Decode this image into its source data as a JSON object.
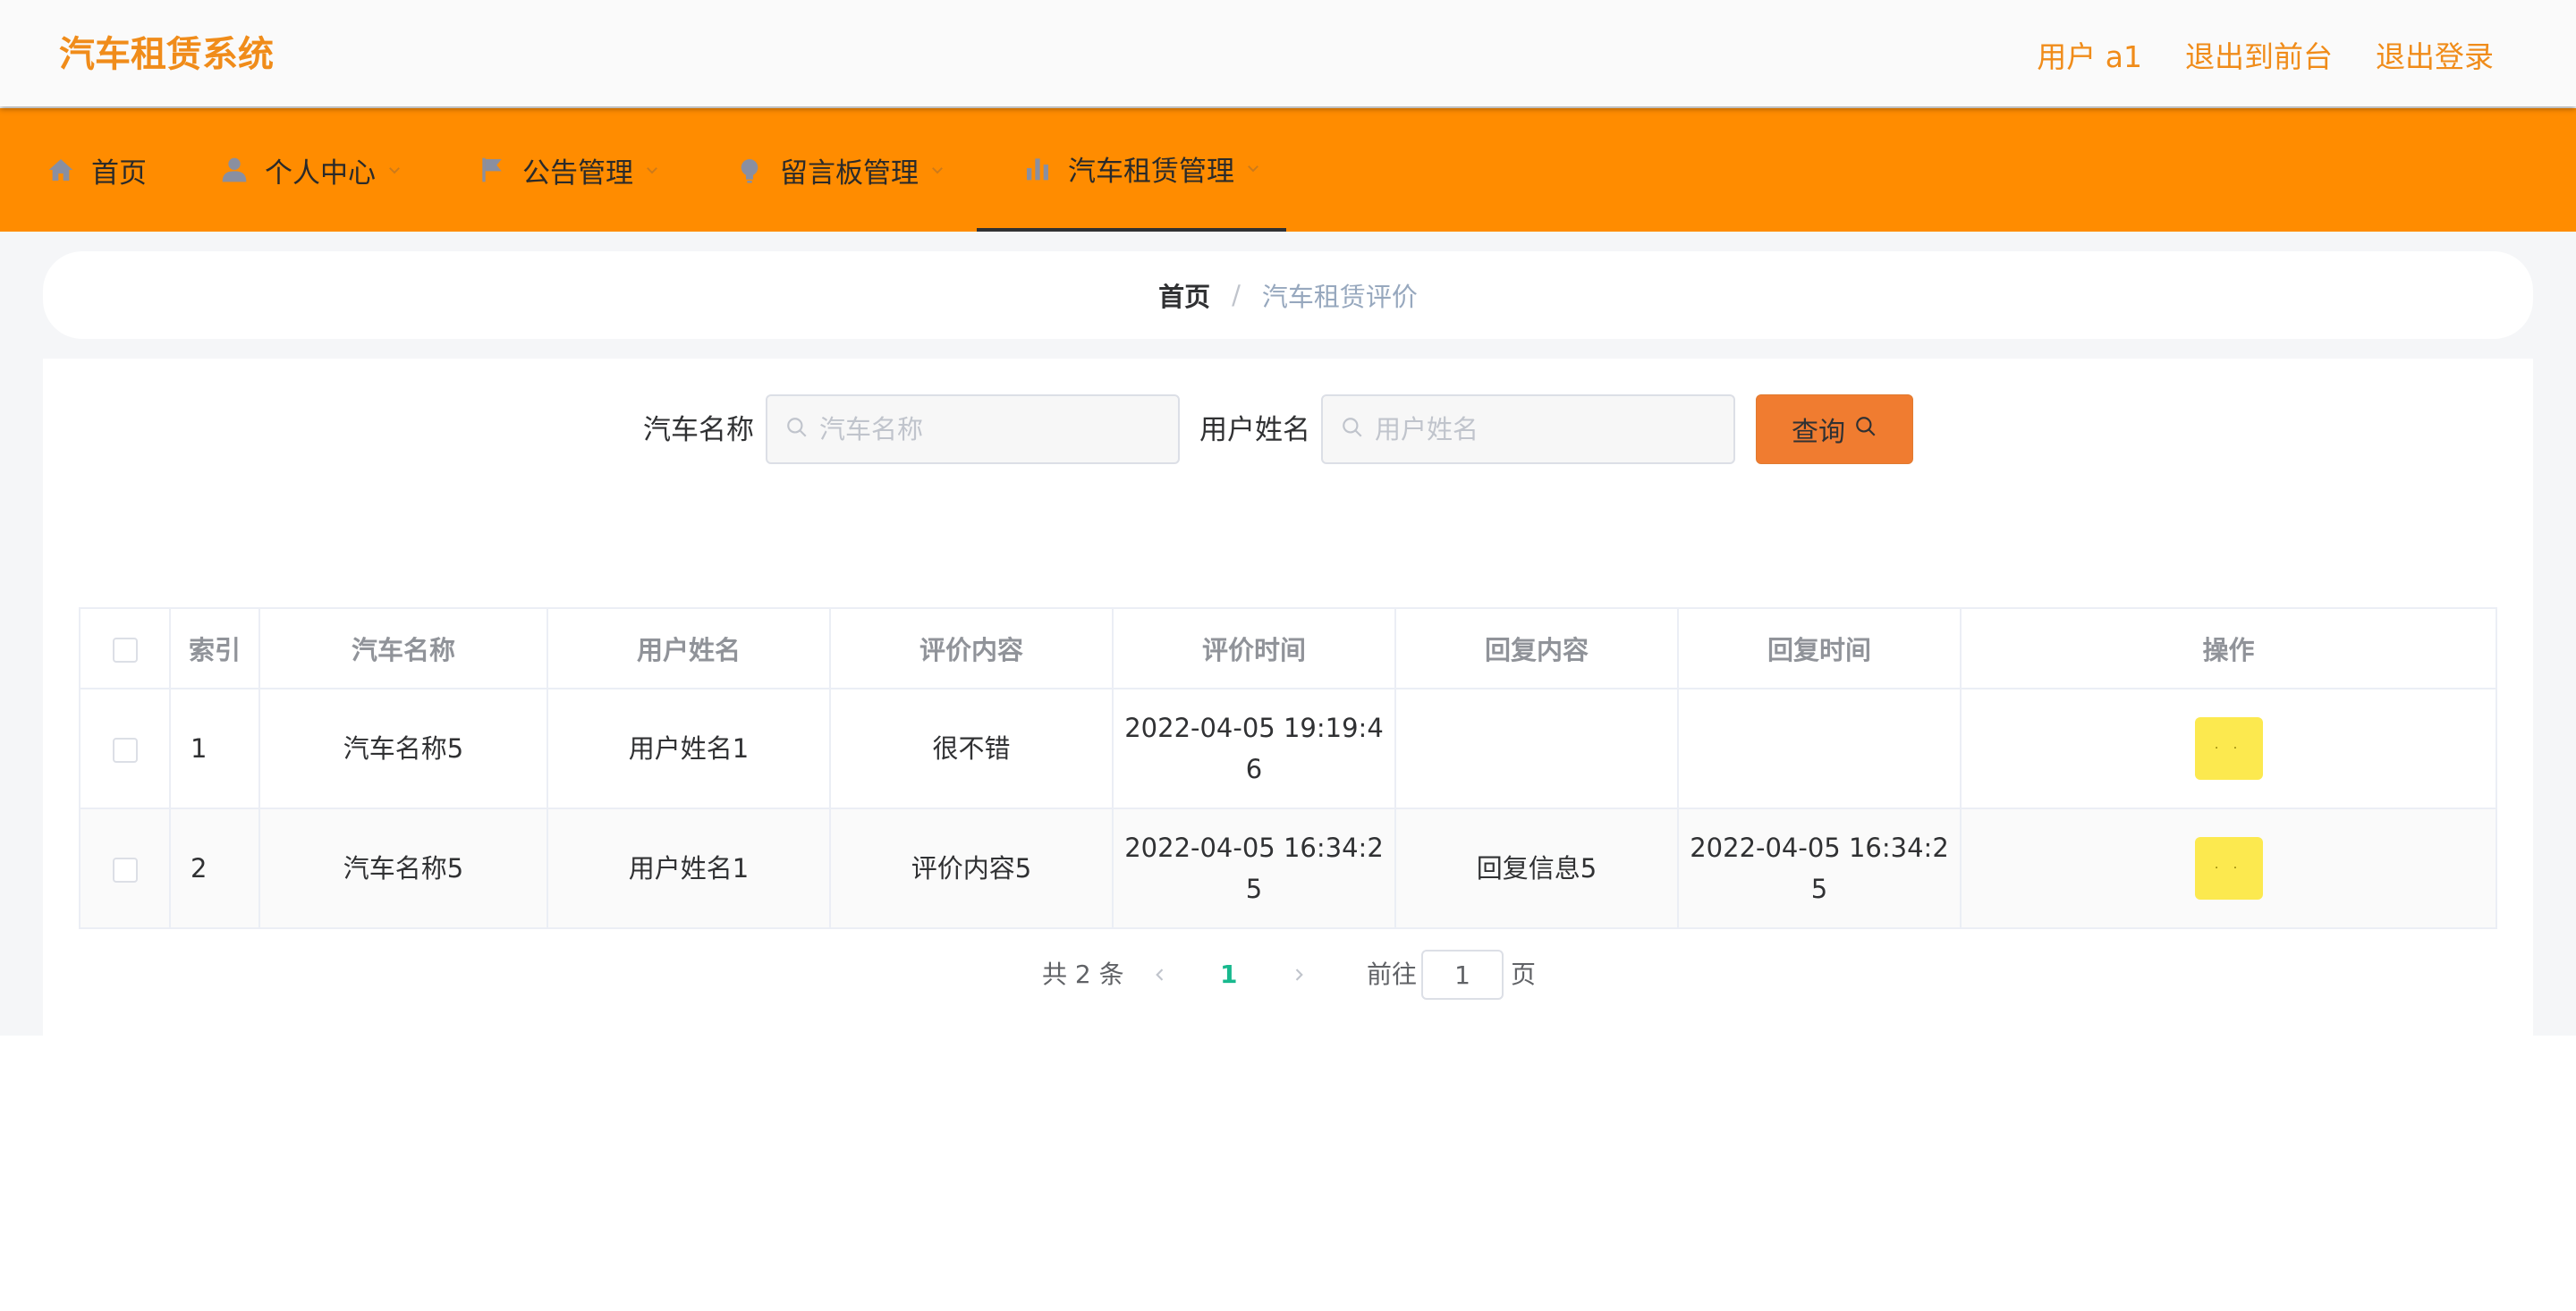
{
  "header": {
    "logo": "汽车租赁系统",
    "user_label": "用户 a1",
    "exit_front_label": "退出到前台",
    "logout_label": "退出登录"
  },
  "nav": {
    "items": [
      {
        "label": "首页",
        "icon": "home-icon"
      },
      {
        "label": "个人中心",
        "icon": "user-icon",
        "has_caret": true
      },
      {
        "label": "公告管理",
        "icon": "flag-icon",
        "has_caret": true
      },
      {
        "label": "留言板管理",
        "icon": "bulb-icon",
        "has_caret": true
      },
      {
        "label": "汽车租赁管理",
        "icon": "chart-icon",
        "has_caret": true,
        "active": true
      }
    ]
  },
  "breadcrumb": {
    "home": "首页",
    "separator": "/",
    "current": "汽车租赁评价"
  },
  "search": {
    "car_name_label": "汽车名称",
    "car_name_placeholder": "汽车名称",
    "car_name_value": "",
    "user_name_label": "用户姓名",
    "user_name_placeholder": "用户姓名",
    "user_name_value": "",
    "query_label": "查询"
  },
  "table": {
    "headers": {
      "index": "索引",
      "car_name": "汽车名称",
      "user_name": "用户姓名",
      "review": "评价内容",
      "review_time": "评价时间",
      "reply": "回复内容",
      "reply_time": "回复时间",
      "actions": "操作"
    },
    "rows": [
      {
        "index": "1",
        "car_name": "汽车名称5",
        "user_name": "用户姓名1",
        "review": "很不错",
        "review_time_line1": "2022-04-05 19:19:4",
        "review_time_line2": "6",
        "reply": "",
        "reply_time_line1": "",
        "reply_time_line2": "",
        "action_label": "· ·"
      },
      {
        "index": "2",
        "car_name": "汽车名称5",
        "user_name": "用户姓名1",
        "review": "评价内容5",
        "review_time_line1": "2022-04-05 16:34:2",
        "review_time_line2": "5",
        "reply": "回复信息5",
        "reply_time_line1": "2022-04-05 16:34:2",
        "reply_time_line2": "5",
        "action_label": "· ·"
      }
    ]
  },
  "pagination": {
    "total_label": "共 2 条",
    "current_page": "1",
    "goto_label": "前往",
    "goto_value": "1",
    "page_unit": "页"
  },
  "colors": {
    "brand_orange": "#ff8c00",
    "logo_text": "#f08c1a",
    "query_button": "#f07c30",
    "active_page": "#18b98e",
    "action_button": "#fce94f"
  }
}
